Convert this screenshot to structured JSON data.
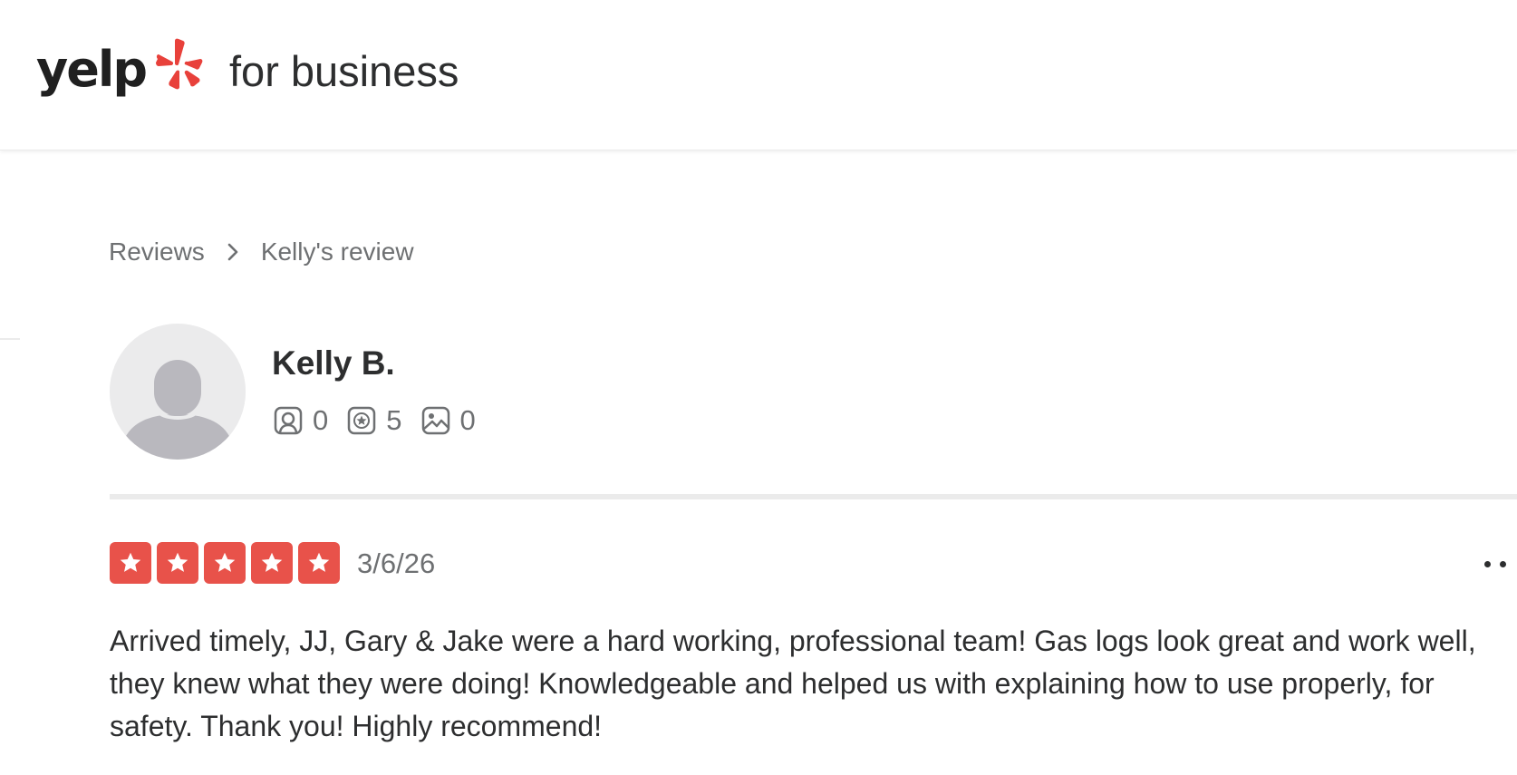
{
  "header": {
    "logo_word": "yelp",
    "logo_subtitle": "for business",
    "logo_icon": "yelp-burst-icon",
    "brand_color": "#d32323"
  },
  "breadcrumb": {
    "items": [
      "Reviews",
      "Kelly's review"
    ],
    "separator_icon": "chevron-right-icon"
  },
  "reviewer": {
    "name": "Kelly B.",
    "avatar_icon": "default-user-avatar",
    "stats": {
      "friends": "0",
      "reviews": "5",
      "photos": "0"
    }
  },
  "review": {
    "rating": 5,
    "rating_max": 5,
    "star_color": "#e8524a",
    "date": "3/6/26",
    "more_icon": "more-options-icon",
    "text": "Arrived timely, JJ, Gary & Jake were a hard working, professional team! Gas logs look great and work well, they knew what they were doing! Knowledgeable and helped us with explaining how to use properly, for safety. Thank you! Highly recommend!"
  }
}
